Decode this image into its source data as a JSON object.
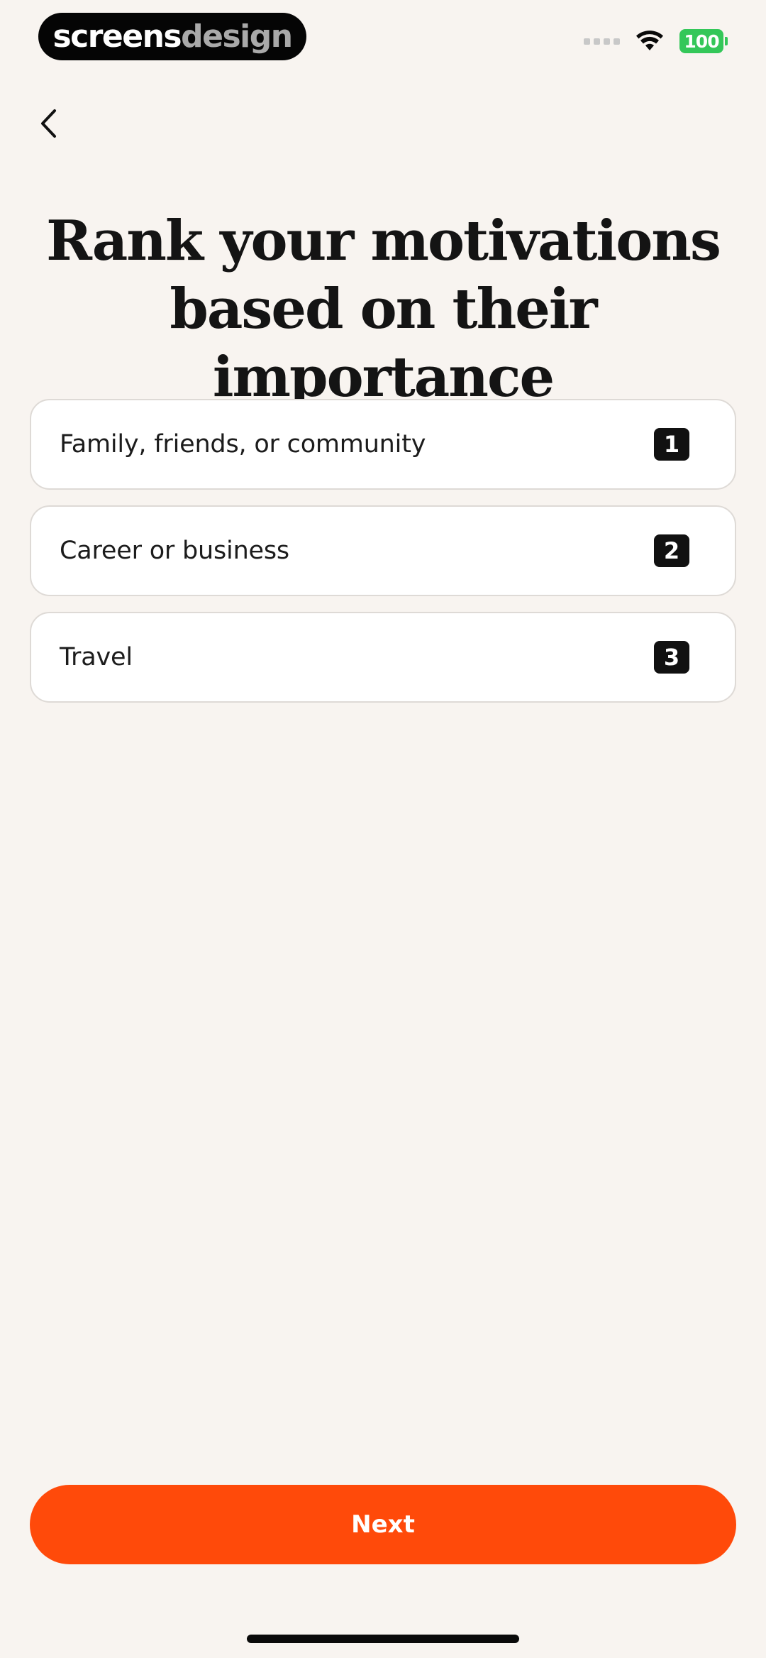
{
  "status_bar": {
    "brand_primary": "screens",
    "brand_secondary": "design",
    "battery_level": "100",
    "icons": [
      "signal-dots-icon",
      "wifi-icon",
      "battery-icon"
    ]
  },
  "nav": {
    "back_icon": "chevron-left-icon"
  },
  "page": {
    "title": "Rank your motivations\nbased on their importance"
  },
  "motivations": [
    {
      "label": "Family, friends, or community",
      "rank": "1"
    },
    {
      "label": "Career or business",
      "rank": "2"
    },
    {
      "label": "Travel",
      "rank": "3"
    }
  ],
  "footer": {
    "next_label": "Next"
  },
  "colors": {
    "background": "#f8f4f0",
    "accent": "#ff4a0a",
    "badge": "#111111",
    "battery": "#34c759"
  }
}
